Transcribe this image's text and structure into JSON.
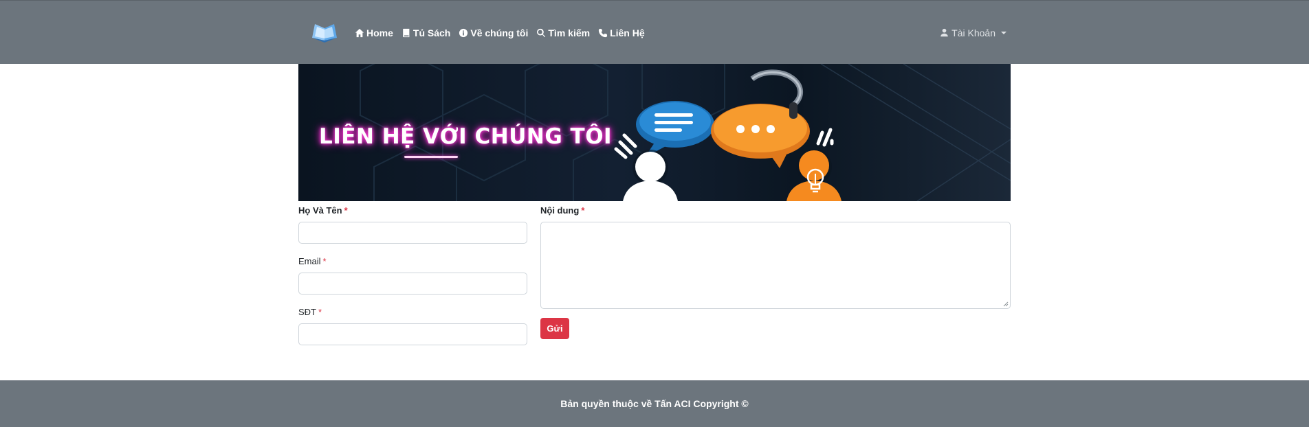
{
  "nav": {
    "logo_icon": "open-book-icon",
    "links": [
      {
        "label": "Home",
        "icon": "home-icon"
      },
      {
        "label": "Tủ Sách",
        "icon": "book-icon"
      },
      {
        "label": "Về chúng tôi",
        "icon": "info-circle-icon"
      },
      {
        "label": "Tìm kiếm",
        "icon": "search-icon"
      },
      {
        "label": "Liên Hệ",
        "icon": "phone-icon"
      }
    ],
    "account_label": "Tài Khoản",
    "account_icon": "user-icon"
  },
  "banner": {
    "title": "LIÊN HỆ VỚI CHÚNG TÔI"
  },
  "form": {
    "name_label": "Họ Và Tên",
    "email_label": "Email",
    "phone_label": "SĐT",
    "content_label": "Nội dung",
    "required_mark": "*",
    "name_value": "",
    "email_value": "",
    "phone_value": "",
    "content_value": "",
    "submit_label": "Gửi"
  },
  "footer": {
    "text": "Bản quyền thuộc về Tấn ACI Copyright ©"
  },
  "colors": {
    "navbar_bg": "#6c757d",
    "submit_bg": "#dc3545",
    "required": "#dc3545",
    "banner_neon": "#ff3fd6"
  }
}
